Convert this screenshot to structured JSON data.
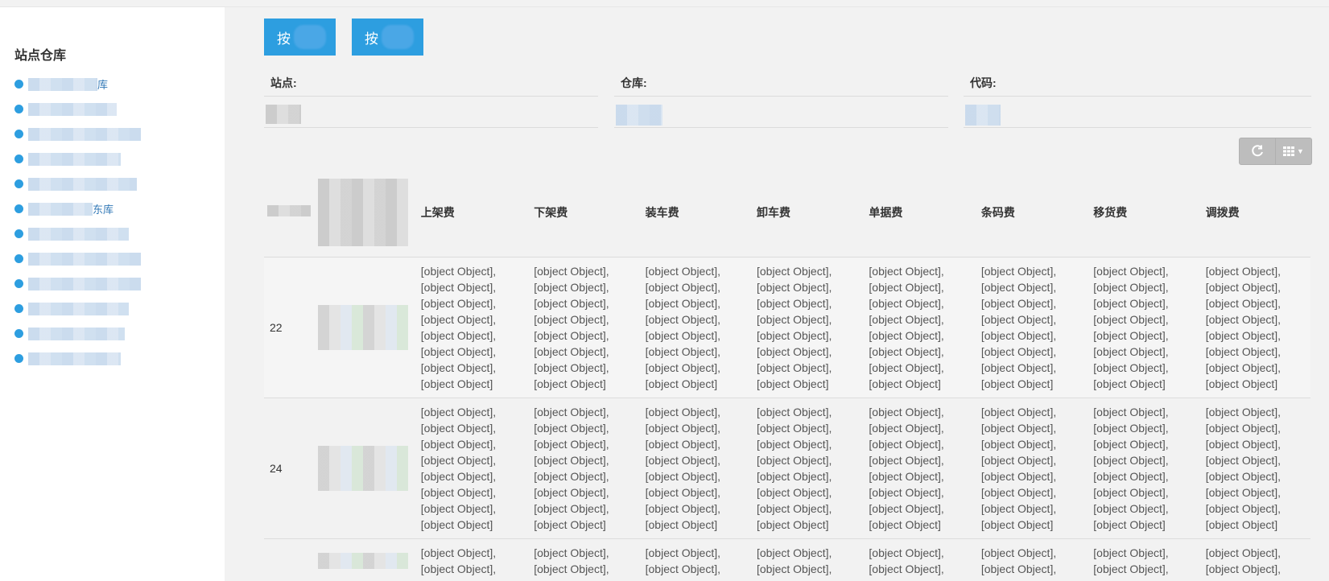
{
  "sidebar": {
    "title": "站点仓库",
    "items": [
      {
        "label": "库"
      },
      {
        "label": ""
      },
      {
        "label": ""
      },
      {
        "label": ""
      },
      {
        "label": ""
      },
      {
        "label": "东库"
      },
      {
        "label": ""
      },
      {
        "label": ""
      },
      {
        "label": ""
      },
      {
        "label": ""
      },
      {
        "label": ""
      },
      {
        "label": ""
      }
    ]
  },
  "toolbar": {
    "button1_label": "按",
    "button2_label": "按"
  },
  "filters": [
    {
      "label": "站点:"
    },
    {
      "label": "仓库:"
    },
    {
      "label": "代码:"
    }
  ],
  "table": {
    "columns": [
      "上架费",
      "下架费",
      "装车费",
      "卸车费",
      "单据费",
      "条码费",
      "移货费",
      "调拨费"
    ],
    "cell_text": "[object Object],",
    "cell_text_last": "[object Object]",
    "rows": [
      {
        "id": "22"
      },
      {
        "id": "24"
      },
      {
        "id": ""
      }
    ]
  },
  "colors": {
    "accent": "#2d9ee0",
    "sidebar_bg": "#ffffff",
    "main_bg": "#f2f2f2",
    "tool_button": "#bdbdbd"
  }
}
